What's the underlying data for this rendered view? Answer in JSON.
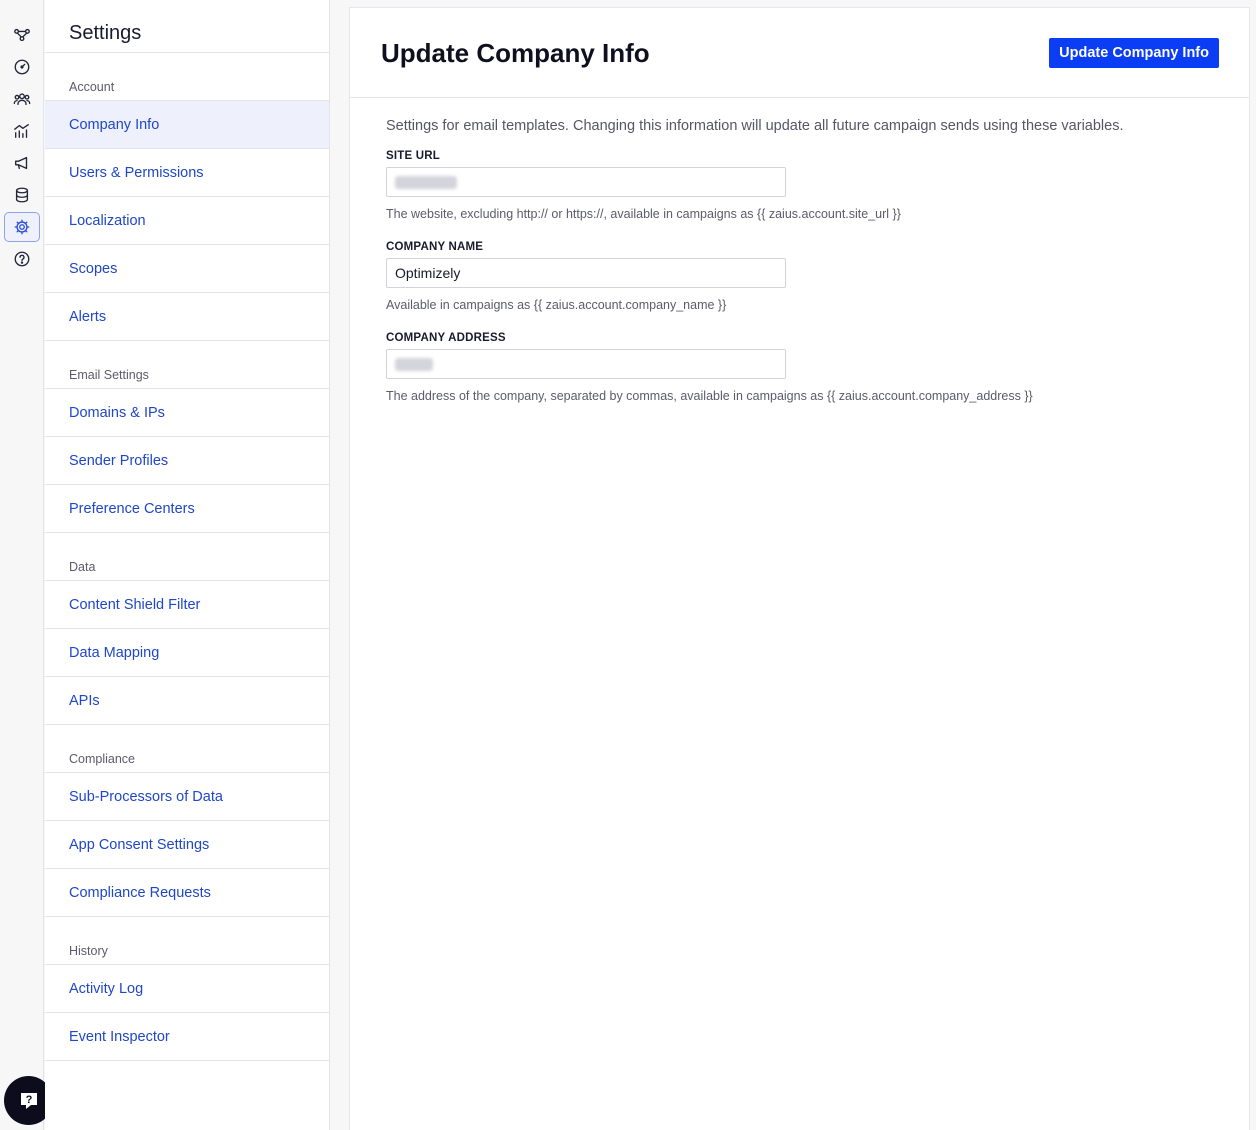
{
  "rail": {
    "icons": [
      "journeys-icon",
      "dashboard-icon",
      "customers-icon",
      "analytics-icon",
      "campaigns-icon",
      "database-icon",
      "settings-icon",
      "help-icon"
    ],
    "active": "settings-icon"
  },
  "nav": {
    "title": "Settings",
    "sections": [
      {
        "label": "Account",
        "items": [
          "Company Info",
          "Users & Permissions",
          "Localization",
          "Scopes",
          "Alerts"
        ]
      },
      {
        "label": "Email Settings",
        "items": [
          "Domains & IPs",
          "Sender Profiles",
          "Preference Centers"
        ]
      },
      {
        "label": "Data",
        "items": [
          "Content Shield Filter",
          "Data Mapping",
          "APIs"
        ]
      },
      {
        "label": "Compliance",
        "items": [
          "Sub-Processors of Data",
          "App Consent Settings",
          "Compliance Requests"
        ]
      },
      {
        "label": "History",
        "items": [
          "Activity Log",
          "Event Inspector"
        ]
      }
    ],
    "active_item": "Company Info"
  },
  "main": {
    "title": "Update Company Info",
    "submit_label": "Update Company Info",
    "intro": "Settings for email templates. Changing this information will update all future campaign sends using these variables.",
    "fields": {
      "site_url": {
        "label": "SITE URL",
        "value": "",
        "help": "The website, excluding http:// or https://, available in campaigns as {{ zaius.account.site_url }}"
      },
      "company_name": {
        "label": "COMPANY NAME",
        "value": "Optimizely",
        "help": "Available in campaigns as {{ zaius.account.company_name }}"
      },
      "company_address": {
        "label": "COMPANY ADDRESS",
        "value": "",
        "help": "The address of the company, separated by commas, available in campaigns as {{ zaius.account.company_address }}"
      }
    }
  },
  "colors": {
    "accent": "#0b3df5",
    "link": "#1f47c7",
    "active_bg": "#eef1fc"
  }
}
